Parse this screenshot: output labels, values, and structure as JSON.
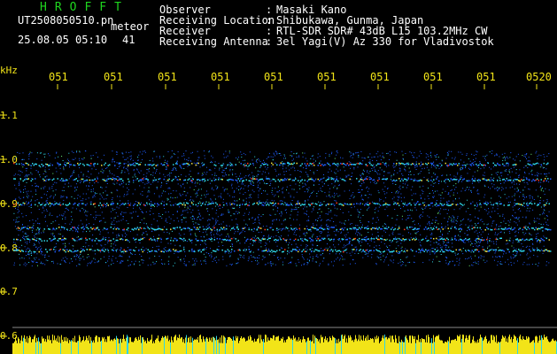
{
  "header": {
    "app_title": "HROFFT",
    "file_name": "UT2508050510.pn",
    "meteor_tag": "meteor",
    "datetime": "25.08.05 05:10",
    "count": "41",
    "fields": [
      {
        "label": "Observer",
        "sep": ":",
        "value": "Masaki Kano"
      },
      {
        "label": "Receiving Location",
        "sep": ":",
        "value": "Shibukawa, Gunma, Japan"
      },
      {
        "label": "Receiver",
        "sep": ":",
        "value": "RTL-SDR SDR# 43dB L15 103.2MHz CW"
      },
      {
        "label": "Receiving Antenna",
        "sep": ":",
        "value": "3el Yagi(V) Az 330 for Vladivostok"
      }
    ]
  },
  "axis": {
    "y_unit": "kHz",
    "y_ticks": [
      "1.1",
      "1.0",
      "0.9",
      "0.8",
      "0.7",
      "0.6"
    ],
    "x_ticks": [
      "051",
      "051",
      "051",
      "051",
      "051",
      "051",
      "051",
      "051",
      "051",
      "0520"
    ]
  },
  "colors": {
    "background": "#000000",
    "header_green": "#1fd61f",
    "axis_yellow": "#f2e418",
    "signal_blue": "#1e5cff",
    "signal_cyan": "#2fd6e6",
    "signal_red": "#ff3a1a"
  },
  "spectrogram": {
    "traces_khz": [
      0.99,
      0.955,
      0.9,
      0.845,
      0.82,
      0.795
    ],
    "activity_level": "high"
  }
}
